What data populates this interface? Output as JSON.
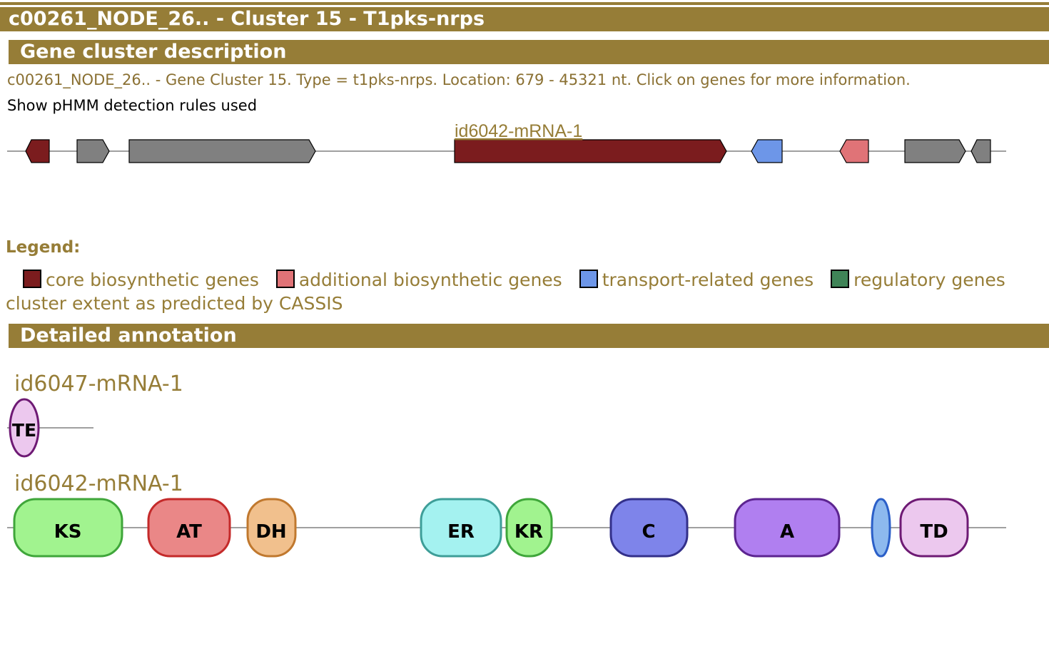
{
  "header": {
    "title": "c00261_NODE_26.. - Cluster 15 - T1pks-nrps"
  },
  "sections": {
    "description_title": "Gene cluster description",
    "annotation_title": "Detailed annotation"
  },
  "description": {
    "text": "c00261_NODE_26.. - Gene Cluster 15. Type = t1pks-nrps. Location: 679 - 45321 nt. Click on genes for more information.",
    "rules_link": "Show pHMM detection rules used"
  },
  "cluster_map": {
    "hover_label": "id6042-mRNA-1",
    "genes": [
      {
        "id": "gene-1",
        "category": "core",
        "strand": "-"
      },
      {
        "id": "gene-2",
        "category": "other",
        "strand": "+"
      },
      {
        "id": "gene-3",
        "category": "other",
        "strand": "+"
      },
      {
        "id": "gene-4",
        "category": "core",
        "strand": "+"
      },
      {
        "id": "gene-5",
        "category": "transport",
        "strand": "-"
      },
      {
        "id": "gene-6",
        "category": "additional",
        "strand": "-"
      },
      {
        "id": "gene-7",
        "category": "other",
        "strand": "+"
      },
      {
        "id": "gene-8",
        "category": "other",
        "strand": "-"
      }
    ]
  },
  "legend": {
    "title": "Legend:",
    "items": [
      {
        "label": "core biosynthetic genes",
        "color": "#7b1c1e"
      },
      {
        "label": "additional biosynthetic genes",
        "color": "#e07377"
      },
      {
        "label": "transport-related genes",
        "color": "#6d96e8"
      },
      {
        "label": "regulatory genes",
        "color": "#3f8457"
      }
    ],
    "cassis_label": "cluster extent as predicted by CASSIS"
  },
  "annotation": {
    "genes": [
      {
        "name": "id6047-mRNA-1",
        "domains": [
          {
            "label": "TE",
            "fill": "#ecc8ee",
            "stroke": "#6e1a74"
          }
        ]
      },
      {
        "name": "id6042-mRNA-1",
        "domains": [
          {
            "label": "KS",
            "fill": "#a1f38f",
            "stroke": "#3fa63a"
          },
          {
            "label": "AT",
            "fill": "#ea8787",
            "stroke": "#c42a2a"
          },
          {
            "label": "DH",
            "fill": "#f1c08d",
            "stroke": "#c0782e"
          },
          {
            "label": "ER",
            "fill": "#a4f2f0",
            "stroke": "#3e9e98"
          },
          {
            "label": "KR",
            "fill": "#a1f38f",
            "stroke": "#3fa63a"
          },
          {
            "label": "C",
            "fill": "#7e84ea",
            "stroke": "#33308a"
          },
          {
            "label": "A",
            "fill": "#b07ff0",
            "stroke": "#5c2490"
          },
          {
            "label": "",
            "fill": "#8db9ee",
            "stroke": "#2b5fc8"
          },
          {
            "label": "TD",
            "fill": "#ecc8ee",
            "stroke": "#6e1a74"
          }
        ]
      }
    ]
  }
}
